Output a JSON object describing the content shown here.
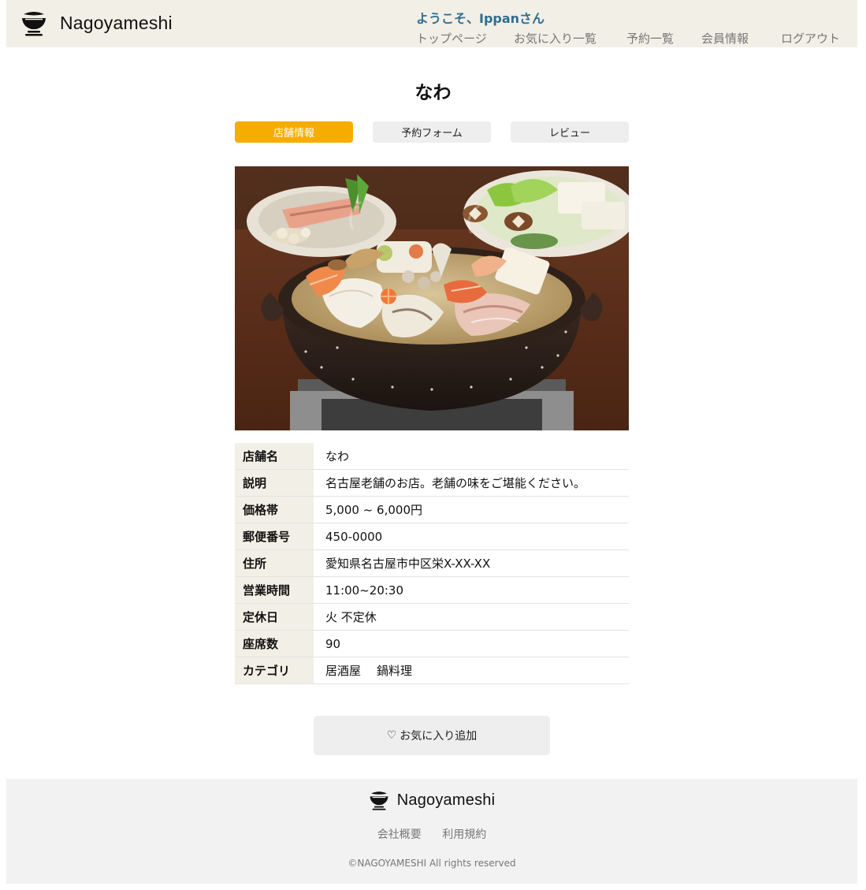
{
  "header": {
    "brand": "Nagoyameshi",
    "logo_icon": "bowl-icon",
    "welcome": "ようこそ、Ippanさん",
    "nav": {
      "top": "トップページ",
      "favorites": "お気に入り一覧",
      "reservations": "予約一覧",
      "member": "会員情報",
      "logout": "ログアウト"
    }
  },
  "restaurant": {
    "title": "なわ",
    "tabs": {
      "info": "店舗情報",
      "reserve": "予約フォーム",
      "review": "レビュー"
    },
    "rows": [
      {
        "label": "店舗名",
        "value": "なわ"
      },
      {
        "label": "説明",
        "value": "名古屋老舗のお店。老舗の味をご堪能ください。"
      },
      {
        "label": "価格帯",
        "value": "5,000 ~ 6,000円"
      },
      {
        "label": "郵便番号",
        "value": "450-0000"
      },
      {
        "label": "住所",
        "value": "愛知県名古屋市中区栄X-XX-XX"
      },
      {
        "label": "営業時間",
        "value": "11:00~20:30"
      },
      {
        "label": "定休日",
        "value": "火 不定休"
      },
      {
        "label": "座席数",
        "value": "90"
      }
    ],
    "category_label": "カテゴリ",
    "categories": [
      "居酒屋",
      "鍋料理"
    ],
    "favorite_button": {
      "icon": "♡",
      "label": "お気に入り追加"
    }
  },
  "footer": {
    "brand": "Nagoyameshi",
    "links": {
      "company": "会社概要",
      "terms": "利用規約"
    },
    "copyright": "©NAGOYAMESHI All rights reserved"
  },
  "colors": {
    "header_bg": "#f2efe6",
    "accent": "#f7ac00",
    "welcome": "#2f6f8f",
    "footer_bg": "#f2f2f2"
  }
}
